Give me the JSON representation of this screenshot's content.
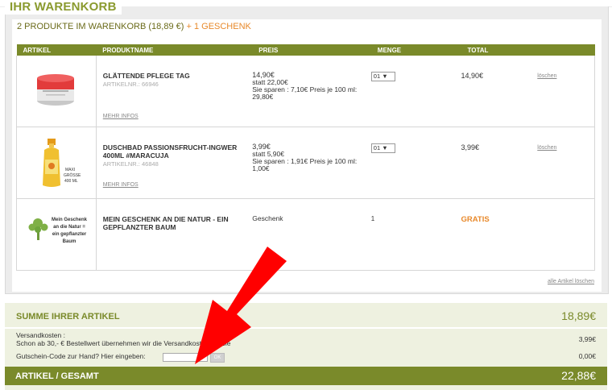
{
  "header": {
    "title": "IHR WARENKORB"
  },
  "summary": {
    "count_text": "2 PRODUKTE IM WARENKORB (18,89 €)",
    "gift_text": "+ 1 GESCHENK"
  },
  "table": {
    "columns": [
      "ARTIKEL",
      "PRODUKTNAME",
      "PREIS",
      "MENGE",
      "TOTAL"
    ],
    "rows": [
      {
        "image": "cream-jar-image",
        "name": "GLÄTTENDE PFLEGE TAG",
        "article": "ARTIKELNR.: 66946",
        "more": "MEHR INFOS",
        "price": "14,90€",
        "price_was": "statt 22,00€",
        "price_save": "Sie sparen : 7,10€ Preis je 100 ml: 29,80€",
        "qty": "01",
        "total": "14,90€",
        "delete": "löschen"
      },
      {
        "image": "shower-gel-bottle-image",
        "image_caption": "MAXI GRÖSSE 400 ML",
        "name": "DUSCHBAD PASSIONSFRUCHT-INGWER 400ML #MARACUJA",
        "article": "ARTIKELNR.: 46848",
        "more": "MEHR INFOS",
        "price": "3,99€",
        "price_was": "statt 5,90€",
        "price_save": "Sie sparen : 1,91€ Preis je 100 ml: 1,00€",
        "qty": "01",
        "total": "3,99€",
        "delete": "löschen"
      },
      {
        "image": "tree-gift-image",
        "image_caption": "Mein Geschenk an die Natur = ein gepflanzter Baum",
        "name": "MEIN GESCHENK AN DIE NATUR - EIN GEPFLANZTER BAUM",
        "price": "Geschenk",
        "qty": "1",
        "total": "GRATIS"
      }
    ],
    "delete_all": "alle Artikel löschen"
  },
  "totals": {
    "sum_label": "SUMME IHRER ARTIKEL",
    "sum_value": "18,89€",
    "shipping_label": "Versandkosten :",
    "shipping_note": "Schon ab 30,- € Bestellwert übernehmen wir die Versandkosten für Sie",
    "shipping_value": "3,99€",
    "coupon_label": "Gutschein-Code zur Hand? Hier eingeben:",
    "coupon_button": "OK",
    "coupon_value": "0,00€",
    "grand_label": "ARTIKEL / GESAMT",
    "grand_value": "22,88€"
  },
  "colors": {
    "accent": "#7a8a2a",
    "gift": "#e8892b",
    "arrow": "#ff0000"
  }
}
